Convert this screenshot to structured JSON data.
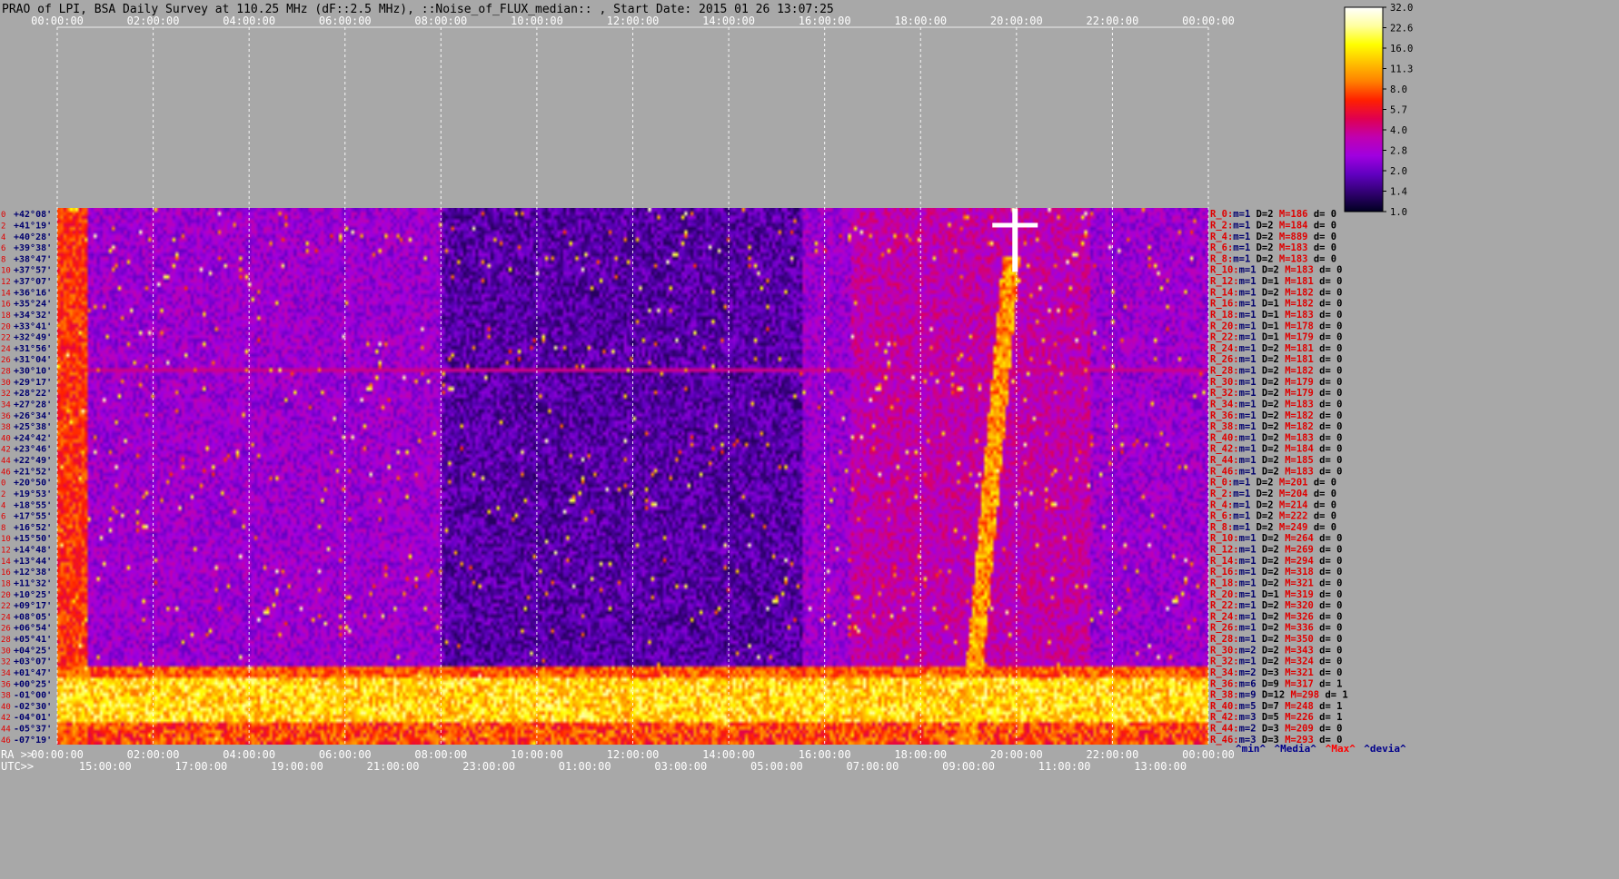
{
  "title": "PRAO of LPI, BSA Daily Survey at 110.25 MHz (dF::2.5 MHz), ::Noise_of_FLUX_median:: , Start Date: 2015 01 26 13:07:25",
  "footer": {
    "ra_prefix": "RA >>",
    "utc_prefix": "UTC>>",
    "legend": [
      {
        "text": "^min^",
        "color": "#00008b"
      },
      {
        "text": "^Media^",
        "color": "#00008b"
      },
      {
        "text": "^Max^",
        "color": "#ff0000"
      },
      {
        "text": "^devia^",
        "color": "#00008b"
      }
    ]
  },
  "colors": {
    "background": "#a8a8a8",
    "label_red": "#e00000",
    "label_navy": "#00006e",
    "gridline": "#ffffff"
  },
  "chart_data": {
    "type": "heatmap",
    "x_axis_top": {
      "label_prefix": "",
      "ticks": [
        "00:00:00",
        "02:00:00",
        "04:00:00",
        "06:00:00",
        "08:00:00",
        "10:00:00",
        "12:00:00",
        "14:00:00",
        "16:00:00",
        "18:00:00",
        "20:00:00",
        "22:00:00",
        "00:00:00"
      ]
    },
    "x_axis_ra": {
      "ticks": [
        "00:00:00",
        "02:00:00",
        "04:00:00",
        "06:00:00",
        "08:00:00",
        "10:00:00",
        "12:00:00",
        "14:00:00",
        "16:00:00",
        "18:00:00",
        "20:00:00",
        "22:00:00",
        "00:00:00"
      ]
    },
    "x_axis_utc": {
      "ticks": [
        "15:00:00",
        "17:00:00",
        "19:00:00",
        "21:00:00",
        "23:00:00",
        "01:00:00",
        "03:00:00",
        "05:00:00",
        "07:00:00",
        "09:00:00",
        "11:00:00",
        "13:00:00"
      ]
    },
    "colorbar": {
      "ticks": [
        "32.0",
        "22.6",
        "16.0",
        "11.3",
        "8.0",
        "5.7",
        "4.0",
        "2.8",
        "2.0",
        "1.4",
        "1.0"
      ],
      "gradient": [
        "#ffffff",
        "#ffffa0",
        "#ffff00",
        "#ffc000",
        "#ff8000",
        "#ff2000",
        "#e00050",
        "#c000b0",
        "#a000e0",
        "#6000c0",
        "#300070",
        "#000020"
      ]
    },
    "declinations": [
      "+42°08'",
      "+41°19'",
      "+40°28'",
      "+39°38'",
      "+38°47'",
      "+37°57'",
      "+37°07'",
      "+36°16'",
      "+35°24'",
      "+34°32'",
      "+33°41'",
      "+32°49'",
      "+31°56'",
      "+31°04'",
      "+30°10'",
      "+29°17'",
      "+28°22'",
      "+27°28'",
      "+26°34'",
      "+25°38'",
      "+24°42'",
      "+23°46'",
      "+22°49'",
      "+21°52'",
      "+20°50'",
      "+19°53'",
      "+18°55'",
      "+17°55'",
      "+16°52'",
      "+15°50'",
      "+14°48'",
      "+13°44'",
      "+12°38'",
      "+11°32'",
      "+10°25'",
      "+09°17'",
      "+08°05'",
      "+06°54'",
      "+05°41'",
      "+04°25'",
      "+03°07'",
      "+01°47'",
      "+00°25'",
      "-01°00'",
      "-02°30'",
      "-04°01'",
      "-05°37'",
      "-07°19'"
    ],
    "row_numbers_left": [
      "0",
      "2",
      "4",
      "6",
      "8",
      "10",
      "12",
      "14",
      "16",
      "18",
      "20",
      "22",
      "24",
      "26",
      "28",
      "30",
      "32",
      "34",
      "36",
      "38",
      "40",
      "42",
      "44",
      "46",
      "0",
      "2",
      "4",
      "6",
      "8",
      "10",
      "12",
      "14",
      "16",
      "18",
      "20",
      "22",
      "24",
      "26",
      "28",
      "30",
      "32",
      "34",
      "36",
      "38",
      "40",
      "42",
      "44",
      "46"
    ],
    "row_stats": [
      {
        "r": "R_0:",
        "m": "m=1",
        "D": "D=2",
        "M": "M=186",
        "d": "d= 0"
      },
      {
        "r": "R_2:",
        "m": "m=1",
        "D": "D=2",
        "M": "M=184",
        "d": "d= 0"
      },
      {
        "r": "R_4:",
        "m": "m=1",
        "D": "D=2",
        "M": "M=889",
        "d": "d= 0"
      },
      {
        "r": "R_6:",
        "m": "m=1",
        "D": "D=2",
        "M": "M=183",
        "d": "d= 0"
      },
      {
        "r": "R_8:",
        "m": "m=1",
        "D": "D=2",
        "M": "M=183",
        "d": "d= 0"
      },
      {
        "r": "R_10:",
        "m": "m=1",
        "D": "D=2",
        "M": "M=183",
        "d": "d= 0"
      },
      {
        "r": "R_12:",
        "m": "m=1",
        "D": "D=1",
        "M": "M=181",
        "d": "d= 0"
      },
      {
        "r": "R_14:",
        "m": "m=1",
        "D": "D=2",
        "M": "M=182",
        "d": "d= 0"
      },
      {
        "r": "R_16:",
        "m": "m=1",
        "D": "D=1",
        "M": "M=182",
        "d": "d= 0"
      },
      {
        "r": "R_18:",
        "m": "m=1",
        "D": "D=1",
        "M": "M=183",
        "d": "d= 0"
      },
      {
        "r": "R_20:",
        "m": "m=1",
        "D": "D=1",
        "M": "M=178",
        "d": "d= 0"
      },
      {
        "r": "R_22:",
        "m": "m=1",
        "D": "D=1",
        "M": "M=179",
        "d": "d= 0"
      },
      {
        "r": "R_24:",
        "m": "m=1",
        "D": "D=2",
        "M": "M=181",
        "d": "d= 0"
      },
      {
        "r": "R_26:",
        "m": "m=1",
        "D": "D=2",
        "M": "M=181",
        "d": "d= 0"
      },
      {
        "r": "R_28:",
        "m": "m=1",
        "D": "D=2",
        "M": "M=182",
        "d": "d= 0"
      },
      {
        "r": "R_30:",
        "m": "m=1",
        "D": "D=2",
        "M": "M=179",
        "d": "d= 0"
      },
      {
        "r": "R_32:",
        "m": "m=1",
        "D": "D=2",
        "M": "M=179",
        "d": "d= 0"
      },
      {
        "r": "R_34:",
        "m": "m=1",
        "D": "D=2",
        "M": "M=183",
        "d": "d= 0"
      },
      {
        "r": "R_36:",
        "m": "m=1",
        "D": "D=2",
        "M": "M=182",
        "d": "d= 0"
      },
      {
        "r": "R_38:",
        "m": "m=1",
        "D": "D=2",
        "M": "M=182",
        "d": "d= 0"
      },
      {
        "r": "R_40:",
        "m": "m=1",
        "D": "D=2",
        "M": "M=183",
        "d": "d= 0"
      },
      {
        "r": "R_42:",
        "m": "m=1",
        "D": "D=2",
        "M": "M=184",
        "d": "d= 0"
      },
      {
        "r": "R_44:",
        "m": "m=1",
        "D": "D=2",
        "M": "M=185",
        "d": "d= 0"
      },
      {
        "r": "R_46:",
        "m": "m=1",
        "D": "D=2",
        "M": "M=183",
        "d": "d= 0"
      },
      {
        "r": "R_0:",
        "m": "m=1",
        "D": "D=2",
        "M": "M=201",
        "d": "d= 0"
      },
      {
        "r": "R_2:",
        "m": "m=1",
        "D": "D=2",
        "M": "M=204",
        "d": "d= 0"
      },
      {
        "r": "R_4:",
        "m": "m=1",
        "D": "D=2",
        "M": "M=214",
        "d": "d= 0"
      },
      {
        "r": "R_6:",
        "m": "m=1",
        "D": "D=2",
        "M": "M=222",
        "d": "d= 0"
      },
      {
        "r": "R_8:",
        "m": "m=1",
        "D": "D=2",
        "M": "M=249",
        "d": "d= 0"
      },
      {
        "r": "R_10:",
        "m": "m=1",
        "D": "D=2",
        "M": "M=264",
        "d": "d= 0"
      },
      {
        "r": "R_12:",
        "m": "m=1",
        "D": "D=2",
        "M": "M=269",
        "d": "d= 0"
      },
      {
        "r": "R_14:",
        "m": "m=1",
        "D": "D=2",
        "M": "M=294",
        "d": "d= 0"
      },
      {
        "r": "R_16:",
        "m": "m=1",
        "D": "D=2",
        "M": "M=318",
        "d": "d= 0"
      },
      {
        "r": "R_18:",
        "m": "m=1",
        "D": "D=2",
        "M": "M=321",
        "d": "d= 0"
      },
      {
        "r": "R_20:",
        "m": "m=1",
        "D": "D=1",
        "M": "M=319",
        "d": "d= 0"
      },
      {
        "r": "R_22:",
        "m": "m=1",
        "D": "D=2",
        "M": "M=320",
        "d": "d= 0"
      },
      {
        "r": "R_24:",
        "m": "m=1",
        "D": "D=2",
        "M": "M=326",
        "d": "d= 0"
      },
      {
        "r": "R_26:",
        "m": "m=1",
        "D": "D=2",
        "M": "M=336",
        "d": "d= 0"
      },
      {
        "r": "R_28:",
        "m": "m=1",
        "D": "D=2",
        "M": "M=350",
        "d": "d= 0"
      },
      {
        "r": "R_30:",
        "m": "m=2",
        "D": "D=2",
        "M": "M=343",
        "d": "d= 0"
      },
      {
        "r": "R_32:",
        "m": "m=1",
        "D": "D=2",
        "M": "M=324",
        "d": "d= 0"
      },
      {
        "r": "R_34:",
        "m": "m=2",
        "D": "D=3",
        "M": "M=321",
        "d": "d= 0"
      },
      {
        "r": "R_36:",
        "m": "m=6",
        "D": "D=9",
        "M": "M=317",
        "d": "d= 1"
      },
      {
        "r": "R_38:",
        "m": "m=9",
        "D": "D=12",
        "M": "M=298",
        "d": "d= 1"
      },
      {
        "r": "R_40:",
        "m": "m=5",
        "D": "D=7",
        "M": "M=248",
        "d": "d= 1"
      },
      {
        "r": "R_42:",
        "m": "m=3",
        "D": "D=5",
        "M": "M=226",
        "d": "d= 1"
      },
      {
        "r": "R_44:",
        "m": "m=2",
        "D": "D=3",
        "M": "M=209",
        "d": "d= 0"
      },
      {
        "r": "R_46:",
        "m": "m=3",
        "D": "D=3",
        "M": "M=293",
        "d": "d= 0"
      }
    ],
    "bright_sources": [
      {
        "name": "",
        "ra_hours": 19.97,
        "dec_row": 1.5,
        "intensity": 32.0
      }
    ],
    "grid": true
  }
}
